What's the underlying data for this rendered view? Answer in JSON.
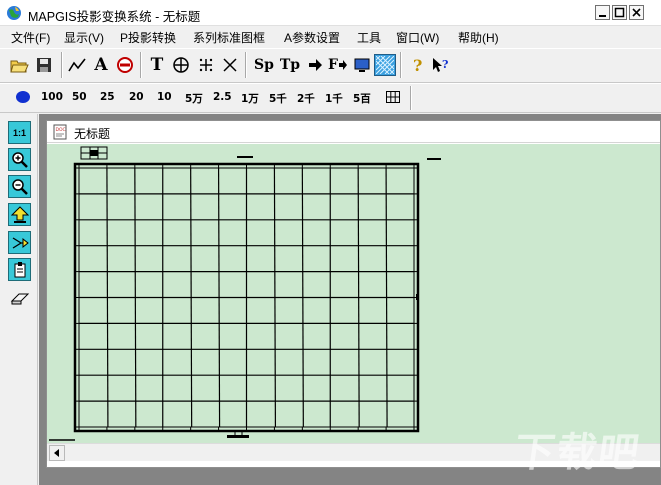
{
  "window": {
    "title": "MAPGIS投影变换系统 - 无标题",
    "controls": {
      "minimize": "_",
      "maximize": "□",
      "close": "X"
    }
  },
  "menu": [
    {
      "label": "文件(F)"
    },
    {
      "label": "显示(V)"
    },
    {
      "label": "P投影转换"
    },
    {
      "label": "系列标准图框"
    },
    {
      "label": "A参数设置"
    },
    {
      "label": "工具"
    },
    {
      "label": "窗口(W)"
    },
    {
      "label": "帮助(H)"
    }
  ],
  "toolbar1": {
    "text_buttons": {
      "text_tool": "T",
      "sp": "Sp",
      "tp": "Tp",
      "ftool": "F",
      "font_tool": "A"
    },
    "help": "?"
  },
  "toolbar2": {
    "scales": [
      "100",
      "50",
      "25",
      "20",
      "10",
      "5万",
      "2.5",
      "1万",
      "5千",
      "2千",
      "1千",
      "5百"
    ]
  },
  "left_toolbar": {
    "actual_size": "1:1"
  },
  "child_window": {
    "title": "无标题"
  },
  "watermark": "下载吧",
  "colors": {
    "canvas_bg": "#cce8cf",
    "workspace_bg": "#848484",
    "tool_accent": "#38c8d8",
    "scale_dot": "#1030d0"
  }
}
